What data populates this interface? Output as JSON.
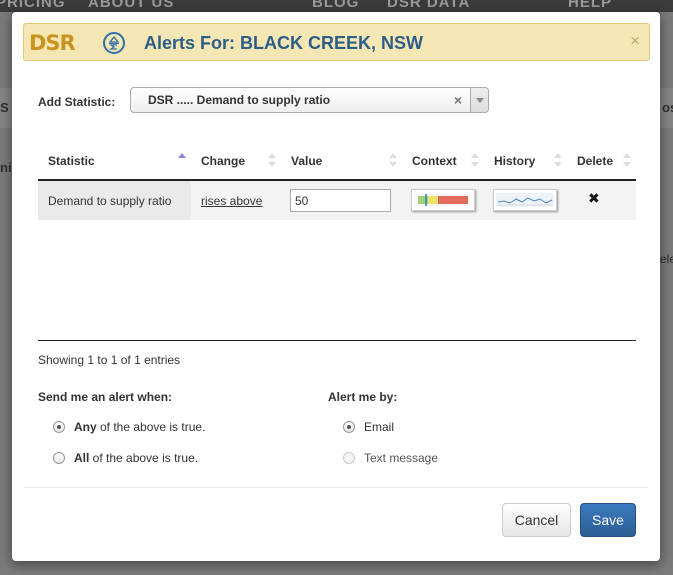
{
  "modal": {
    "logo_text": "DSR",
    "title": "Alerts For: BLACK CREEK, NSW",
    "close_symbol": "×"
  },
  "add_statistic": {
    "label": "Add Statistic:",
    "selected": "DSR ..... Demand to supply ratio",
    "clear_symbol": "×"
  },
  "table": {
    "columns": [
      "Statistic",
      "Change",
      "Value",
      "Context",
      "History",
      "Delete"
    ],
    "sorted_column": "Statistic",
    "rows": [
      {
        "statistic": "Demand to supply ratio",
        "change": "rises above",
        "value": "50",
        "context": "context-thumbnail",
        "history": "history-thumbnail",
        "delete": "✖"
      }
    ],
    "info": "Showing 1 to 1 of 1 entries"
  },
  "send_alert": {
    "label": "Send me an alert when:",
    "options": [
      {
        "bold": "Any",
        "rest": " of the above is true.",
        "checked": true
      },
      {
        "bold": "All",
        "rest": " of the above is true.",
        "checked": false
      }
    ]
  },
  "alert_by": {
    "label": "Alert me by:",
    "options": [
      {
        "label": "Email",
        "checked": true,
        "disabled": false
      },
      {
        "label": "Text message",
        "checked": false,
        "disabled": true
      }
    ]
  },
  "buttons": {
    "cancel": "Cancel",
    "save": "Save"
  },
  "background": {
    "nav_items": [
      "PRICING",
      "ABOUT US",
      "BLOG",
      "DSR DATA",
      "HELP"
    ],
    "side_text": [
      "S",
      "ni",
      "os",
      "ele"
    ]
  },
  "colors": {
    "header_bg": "#f5e7b4",
    "title_color": "#2c5c88",
    "logo_gold": "#c9941e",
    "save_blue": "#2b5d95"
  }
}
